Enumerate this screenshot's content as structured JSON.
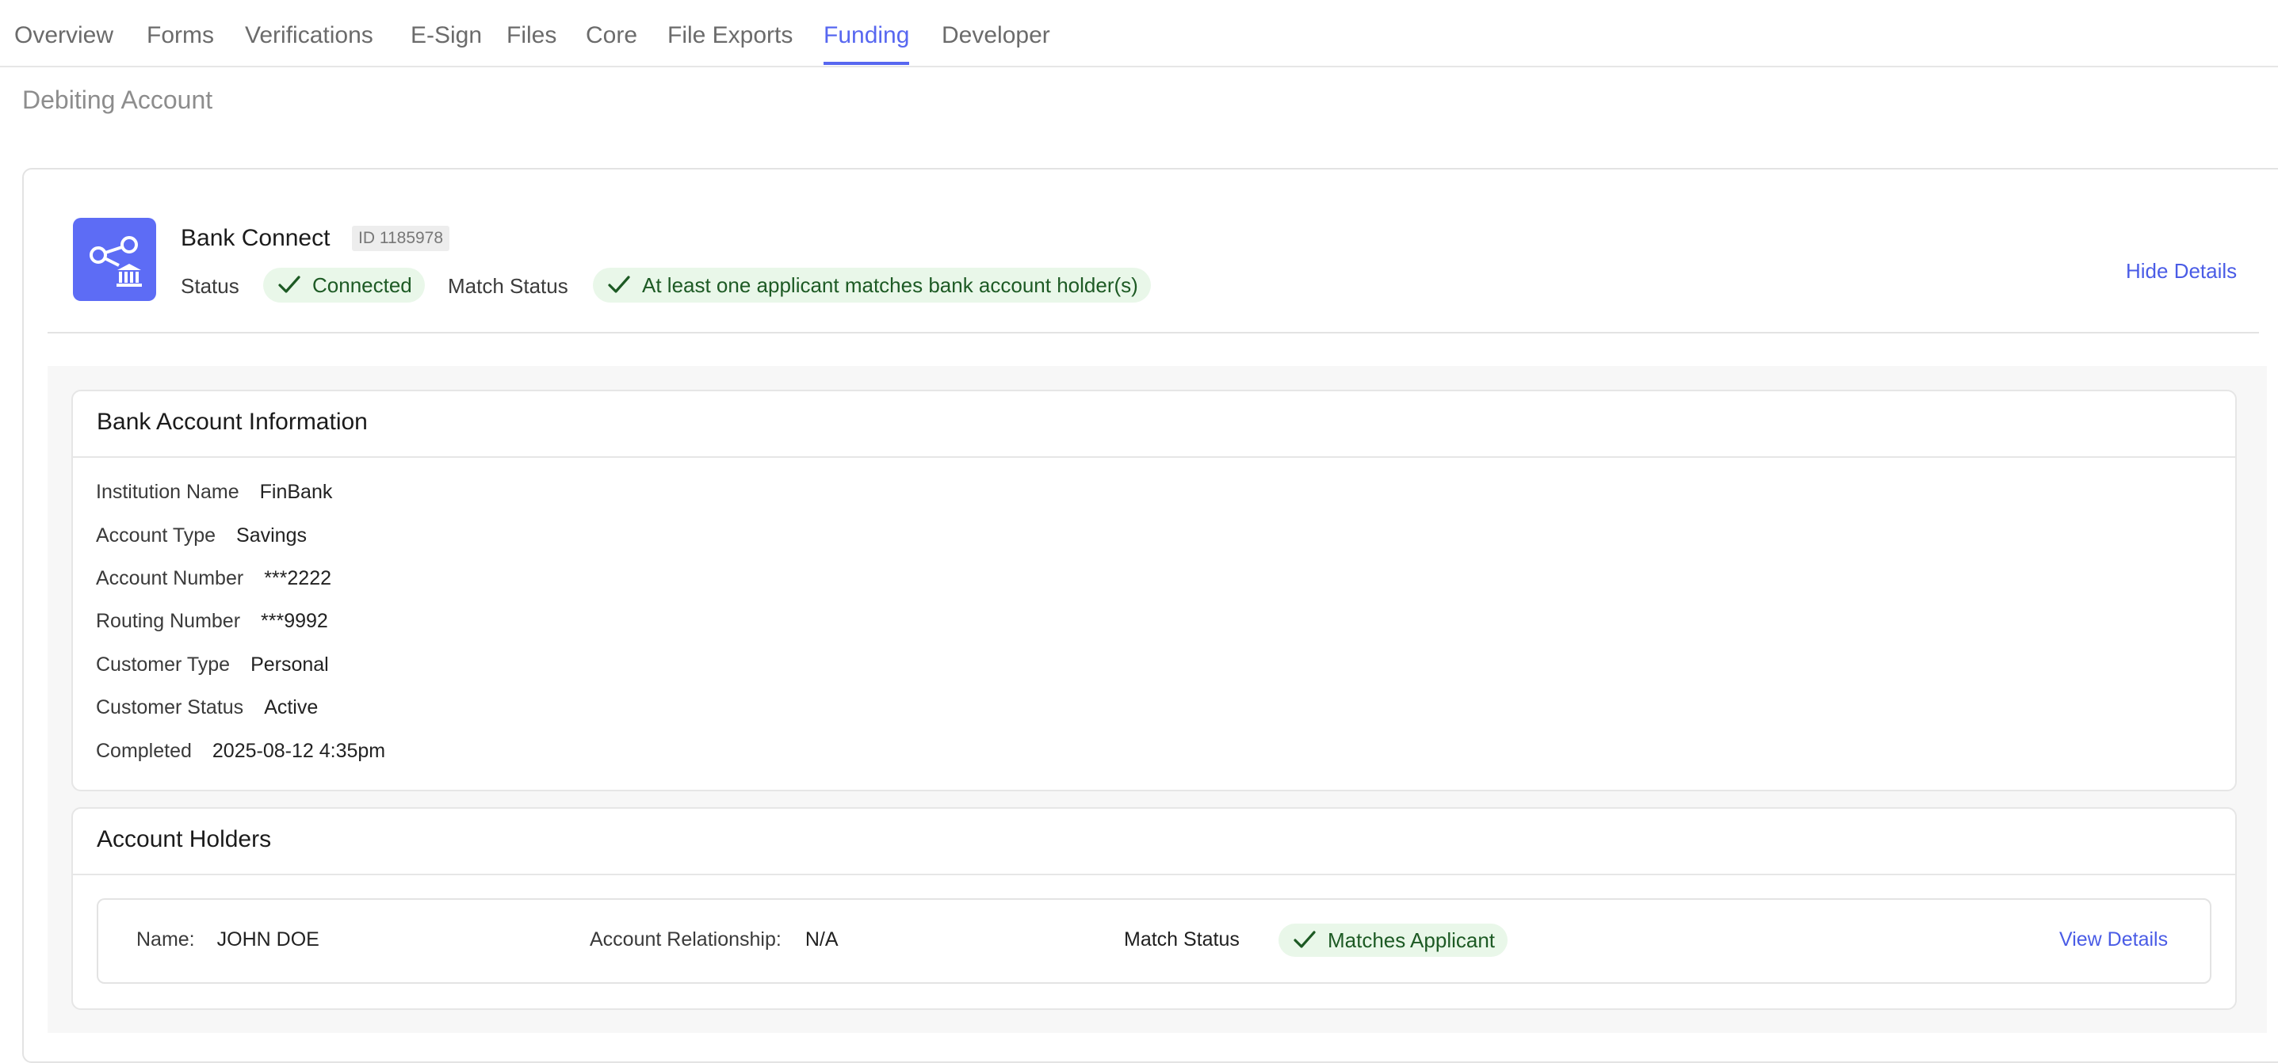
{
  "tabs": [
    {
      "label": "Overview",
      "active": false
    },
    {
      "label": "Forms",
      "active": false
    },
    {
      "label": "Verifications",
      "active": false
    },
    {
      "label": "E-Sign",
      "active": false
    },
    {
      "label": "Files",
      "active": false
    },
    {
      "label": "Core",
      "active": false
    },
    {
      "label": "File Exports",
      "active": false
    },
    {
      "label": "Funding",
      "active": true
    },
    {
      "label": "Developer",
      "active": false
    }
  ],
  "section_title": "Debiting Account",
  "bank_connect": {
    "icon": "bank-connect-icon",
    "title": "Bank Connect",
    "id_label": "ID 1185978",
    "status_label": "Status",
    "status_value": "Connected",
    "match_status_label": "Match Status",
    "match_status_value": "At least one applicant matches bank account holder(s)",
    "hide_details": "Hide Details"
  },
  "bank_account_info": {
    "title": "Bank Account Information",
    "fields": [
      {
        "label": "Institution Name",
        "value": "FinBank"
      },
      {
        "label": "Account Type",
        "value": "Savings"
      },
      {
        "label": "Account Number",
        "value": "***2222"
      },
      {
        "label": "Routing Number",
        "value": "***9992"
      },
      {
        "label": "Customer Type",
        "value": "Personal"
      },
      {
        "label": "Customer Status",
        "value": "Active"
      },
      {
        "label": "Completed",
        "value": "2025-08-12 4:35pm"
      }
    ]
  },
  "account_holders": {
    "title": "Account Holders",
    "rows": [
      {
        "name_label": "Name:",
        "name_value": "JOHN DOE",
        "relationship_label": "Account Relationship:",
        "relationship_value": "N/A",
        "match_label": "Match Status",
        "match_value": "Matches Applicant",
        "view_details": "View Details"
      }
    ]
  },
  "colors": {
    "accent": "#5767f0",
    "success_bg": "#e9f7e9",
    "success_text": "#1d5a24",
    "logo_bg": "#5d6cf5"
  }
}
